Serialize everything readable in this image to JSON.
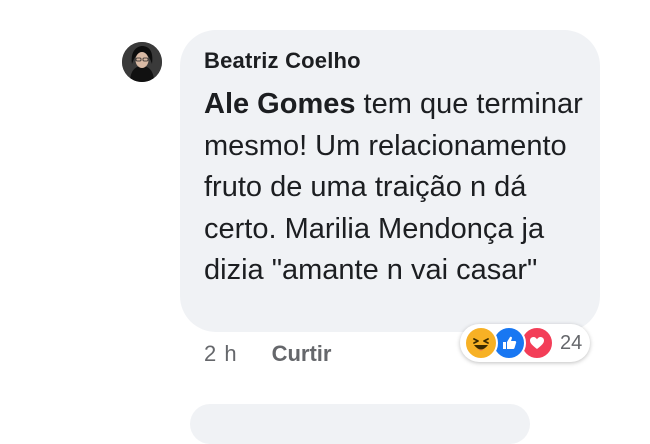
{
  "comment": {
    "author": "Beatriz Coelho",
    "mention": "Ale Gomes",
    "text": " tem que terminar mesmo! Um relacionamento fruto de uma traição n dá certo. Marilia Mendonça ja dizia \"amante n vai casar\""
  },
  "meta": {
    "time": "2 h",
    "like_label": "Curtir"
  },
  "reactions": {
    "types": [
      "haha-icon",
      "like-icon",
      "love-icon"
    ],
    "count": "24"
  },
  "colors": {
    "bubble": "#f0f2f5",
    "like": "#1877f2",
    "love": "#f33e58",
    "haha": "#f7b125"
  }
}
